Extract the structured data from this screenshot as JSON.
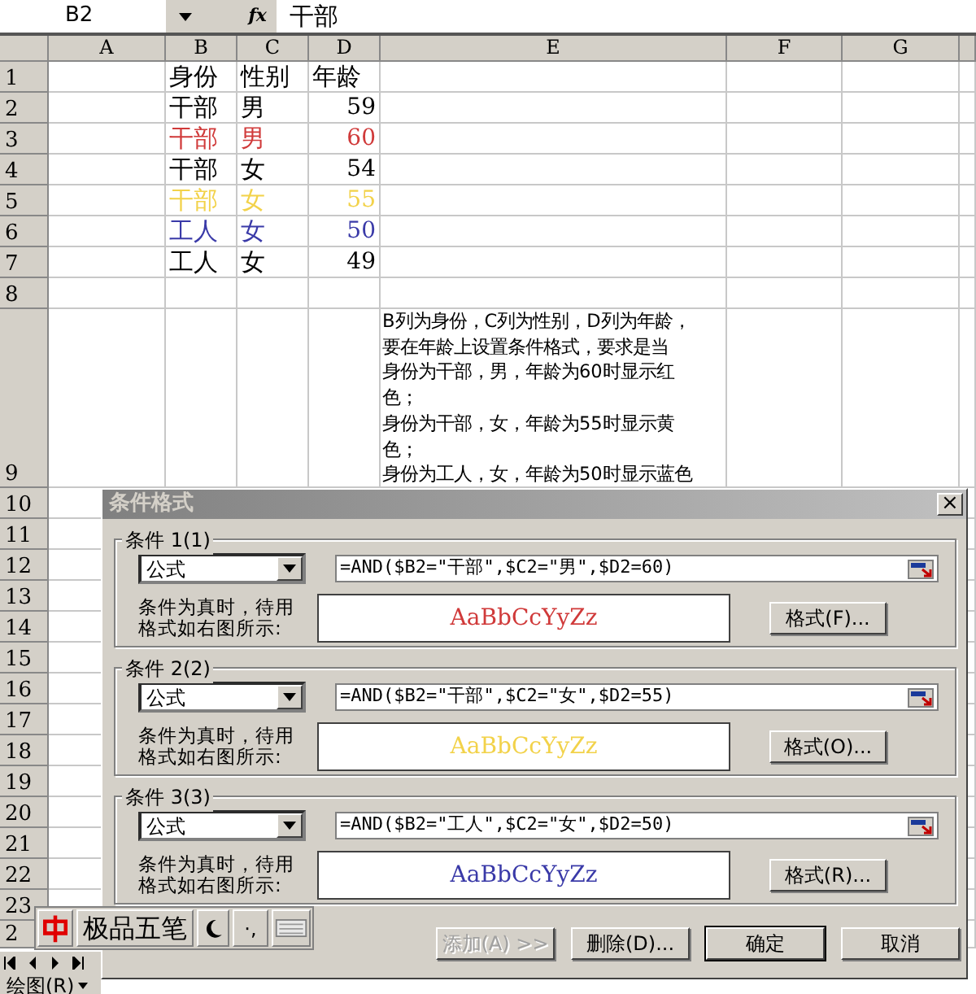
{
  "formula_bar": {
    "name_box": "B2",
    "fx": "fx",
    "value": "干部"
  },
  "columns": [
    "A",
    "B",
    "C",
    "D",
    "E",
    "F",
    "G"
  ],
  "rows": [
    {
      "number": "1",
      "kind": "header",
      "cells": [
        "身份",
        "性别",
        "年龄"
      ]
    },
    {
      "number": "2",
      "kind": "data",
      "cells": [
        "干部",
        "男",
        "59"
      ]
    },
    {
      "number": "3",
      "kind": "data",
      "color": "#d03a3a",
      "cells": [
        "干部",
        "男",
        "60"
      ]
    },
    {
      "number": "4",
      "kind": "data",
      "cells": [
        "干部",
        "女",
        "54"
      ]
    },
    {
      "number": "5",
      "kind": "data",
      "color": "#f2d24a",
      "cells": [
        "干部",
        "女",
        "55"
      ]
    },
    {
      "number": "6",
      "kind": "data",
      "color": "#3a3aa8",
      "cells": [
        "工人",
        "女",
        "50"
      ]
    },
    {
      "number": "7",
      "kind": "data",
      "cells": [
        "工人",
        "女",
        "49"
      ]
    },
    {
      "number": "8",
      "kind": "empty"
    },
    {
      "number": "9",
      "kind": "note",
      "note_lines": [
        "B列为身份，C列为性别，D列为年龄，",
        "要在年龄上设置条件格式，要求是当",
        "身份为干部，男，年龄为60时显示红",
        "色；",
        "身份为干部，女，年龄为55时显示黄",
        "色；",
        "身份为工人，女，年龄为50时显示蓝色"
      ]
    },
    {
      "number": "10",
      "kind": "empty"
    },
    {
      "number": "11",
      "kind": "empty"
    },
    {
      "number": "12",
      "kind": "empty"
    },
    {
      "number": "13",
      "kind": "empty"
    },
    {
      "number": "14",
      "kind": "empty"
    },
    {
      "number": "15",
      "kind": "empty"
    },
    {
      "number": "16",
      "kind": "empty"
    },
    {
      "number": "17",
      "kind": "empty"
    },
    {
      "number": "18",
      "kind": "empty"
    },
    {
      "number": "19",
      "kind": "empty"
    },
    {
      "number": "20",
      "kind": "empty"
    },
    {
      "number": "21",
      "kind": "empty"
    },
    {
      "number": "22",
      "kind": "empty"
    },
    {
      "number": "23",
      "kind": "empty"
    },
    {
      "number": "2",
      "kind": "empty"
    }
  ],
  "dialog": {
    "title": "条件格式",
    "close": "×",
    "conditions": [
      {
        "label": "条件 1(1)",
        "operator": "公式",
        "formula": "=AND($B2=\"干部\",$C2=\"男\",$D2=60)",
        "hint": "条件为真时，待用格式如右图所示:",
        "preview": "AaBbCcYyZz",
        "color": "#d03a3a",
        "format_button": "格式(F)..."
      },
      {
        "label": "条件 2(2)",
        "operator": "公式",
        "formula": "=AND($B2=\"干部\",$C2=\"女\",$D2=55)",
        "hint": "条件为真时，待用格式如右图所示:",
        "preview": "AaBbCcYyZz",
        "color": "#f2d24a",
        "format_button": "格式(O)..."
      },
      {
        "label": "条件 3(3)",
        "operator": "公式",
        "formula": "=AND($B2=\"工人\",$C2=\"女\",$D2=50)",
        "hint": "条件为真时，待用格式如右图所示:",
        "preview": "AaBbCcYyZz",
        "color": "#3a3aa8",
        "format_button": "格式(R)..."
      }
    ],
    "buttons": [
      {
        "label": "添加(A) >>",
        "disabled": true,
        "default": false
      },
      {
        "label": "删除(D)...",
        "disabled": false,
        "default": false
      },
      {
        "label": "确定",
        "disabled": false,
        "default": true
      },
      {
        "label": "取消",
        "disabled": false,
        "default": false
      }
    ]
  },
  "ime_bar": {
    "name": "极品五笔",
    "punctuation": "·,"
  },
  "drawing_toolbar": {
    "label": "绘图(R)"
  }
}
